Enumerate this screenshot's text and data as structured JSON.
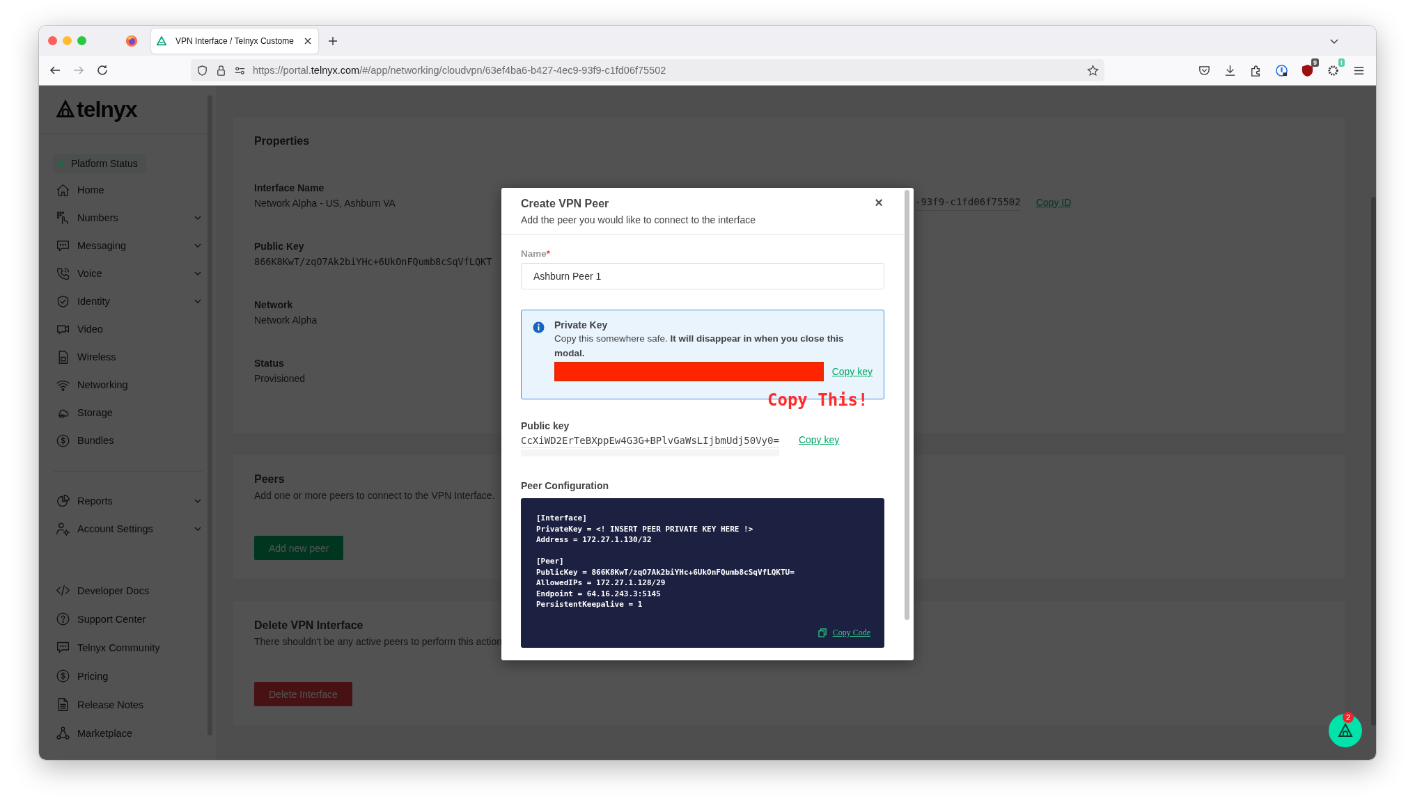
{
  "browser": {
    "tabs": [
      {
        "title": "VPN Interface / Telnyx Custome",
        "selected": true
      }
    ],
    "url": {
      "prefix": "https://portal.",
      "domain": "telnyx.com",
      "path": "/#/app/networking/cloudvpn/63ef4ba6-b427-4ec9-93f9-c1fd06f75502"
    },
    "extension_badges": [
      "9",
      "!"
    ]
  },
  "sidebar": {
    "logo": "telnyx",
    "status": {
      "label": "Platform Status",
      "color": "#1b6a44"
    },
    "sections": [
      {
        "items": [
          {
            "label": "Home",
            "expandable": false
          },
          {
            "label": "Numbers",
            "expandable": true
          },
          {
            "label": "Messaging",
            "expandable": true
          },
          {
            "label": "Voice",
            "expandable": true
          },
          {
            "label": "Identity",
            "expandable": true
          },
          {
            "label": "Video",
            "expandable": false
          },
          {
            "label": "Wireless",
            "expandable": false
          },
          {
            "label": "Networking",
            "expandable": false
          },
          {
            "label": "Storage",
            "expandable": false
          },
          {
            "label": "Bundles",
            "expandable": false
          }
        ]
      },
      {
        "items": [
          {
            "label": "Reports",
            "expandable": true
          },
          {
            "label": "Account Settings",
            "expandable": true
          }
        ]
      },
      {
        "items": [
          {
            "label": "Developer Docs",
            "expandable": false
          },
          {
            "label": "Support Center",
            "expandable": false
          },
          {
            "label": "Telnyx Community",
            "expandable": false
          },
          {
            "label": "Pricing",
            "expandable": false
          },
          {
            "label": "Release Notes",
            "expandable": false
          },
          {
            "label": "Marketplace",
            "expandable": false
          }
        ]
      }
    ]
  },
  "properties": {
    "title": "Properties",
    "fields": [
      {
        "label": "Interface Name",
        "value": "Network Alpha - US, Ashburn VA",
        "kind": "text"
      },
      {
        "label": "Public Key",
        "value": "866K8KwT/zqO7Ak2biYHc+6UkOnFQumb8cSqVfLQKT",
        "kind": "key"
      },
      {
        "label": "Network",
        "value": "Network Alpha",
        "kind": "text"
      },
      {
        "label": "Status",
        "value": "Provisioned",
        "kind": "text"
      }
    ],
    "interface_id": {
      "value": "-93f9-c1fd06f75502",
      "action": "Copy ID"
    }
  },
  "peers": {
    "title": "Peers",
    "description": "Add one or more peers to connect to the VPN Interface.",
    "button": "Add new peer"
  },
  "delete_interface": {
    "title": "Delete VPN Interface",
    "description": "There shouldn't be any active peers to perform this action",
    "button": "Delete Interface"
  },
  "modal": {
    "title": "Create VPN Peer",
    "subtitle": "Add the peer you would like to connect to the interface",
    "close": "×",
    "name_field": {
      "label": "Name",
      "required_mark": "*",
      "value": "Ashburn Peer 1"
    },
    "private_key": {
      "title": "Private Key",
      "message": "Copy this somewhere safe. **It will disappear in when you close this modal.**",
      "action": "Copy key"
    },
    "annotation": "Copy This!",
    "public_key": {
      "label": "Public key",
      "value": "CcXiWD2ErTeBXppEw4G3G+BPlvGaWsLIjbmUdj50Vy0=",
      "action": "Copy key"
    },
    "peer_configuration": {
      "label": "Peer Configuration",
      "blocks": [
        [
          "[Interface]",
          "PrivateKey = <! INSERT PEER PRIVATE KEY HERE !>",
          "Address = 172.27.1.130/32"
        ],
        [
          "[Peer]",
          "PublicKey = 866K8KwT/zqO7Ak2biYHc+6UkOnFQumb8cSqVfLQKTU=",
          "AllowedIPs = 172.27.1.128/29",
          "Endpoint = 64.16.243.3:5145",
          "PersistentKeepalive = 1"
        ]
      ],
      "action": "Copy Code"
    }
  },
  "chat": {
    "badge": "2"
  }
}
